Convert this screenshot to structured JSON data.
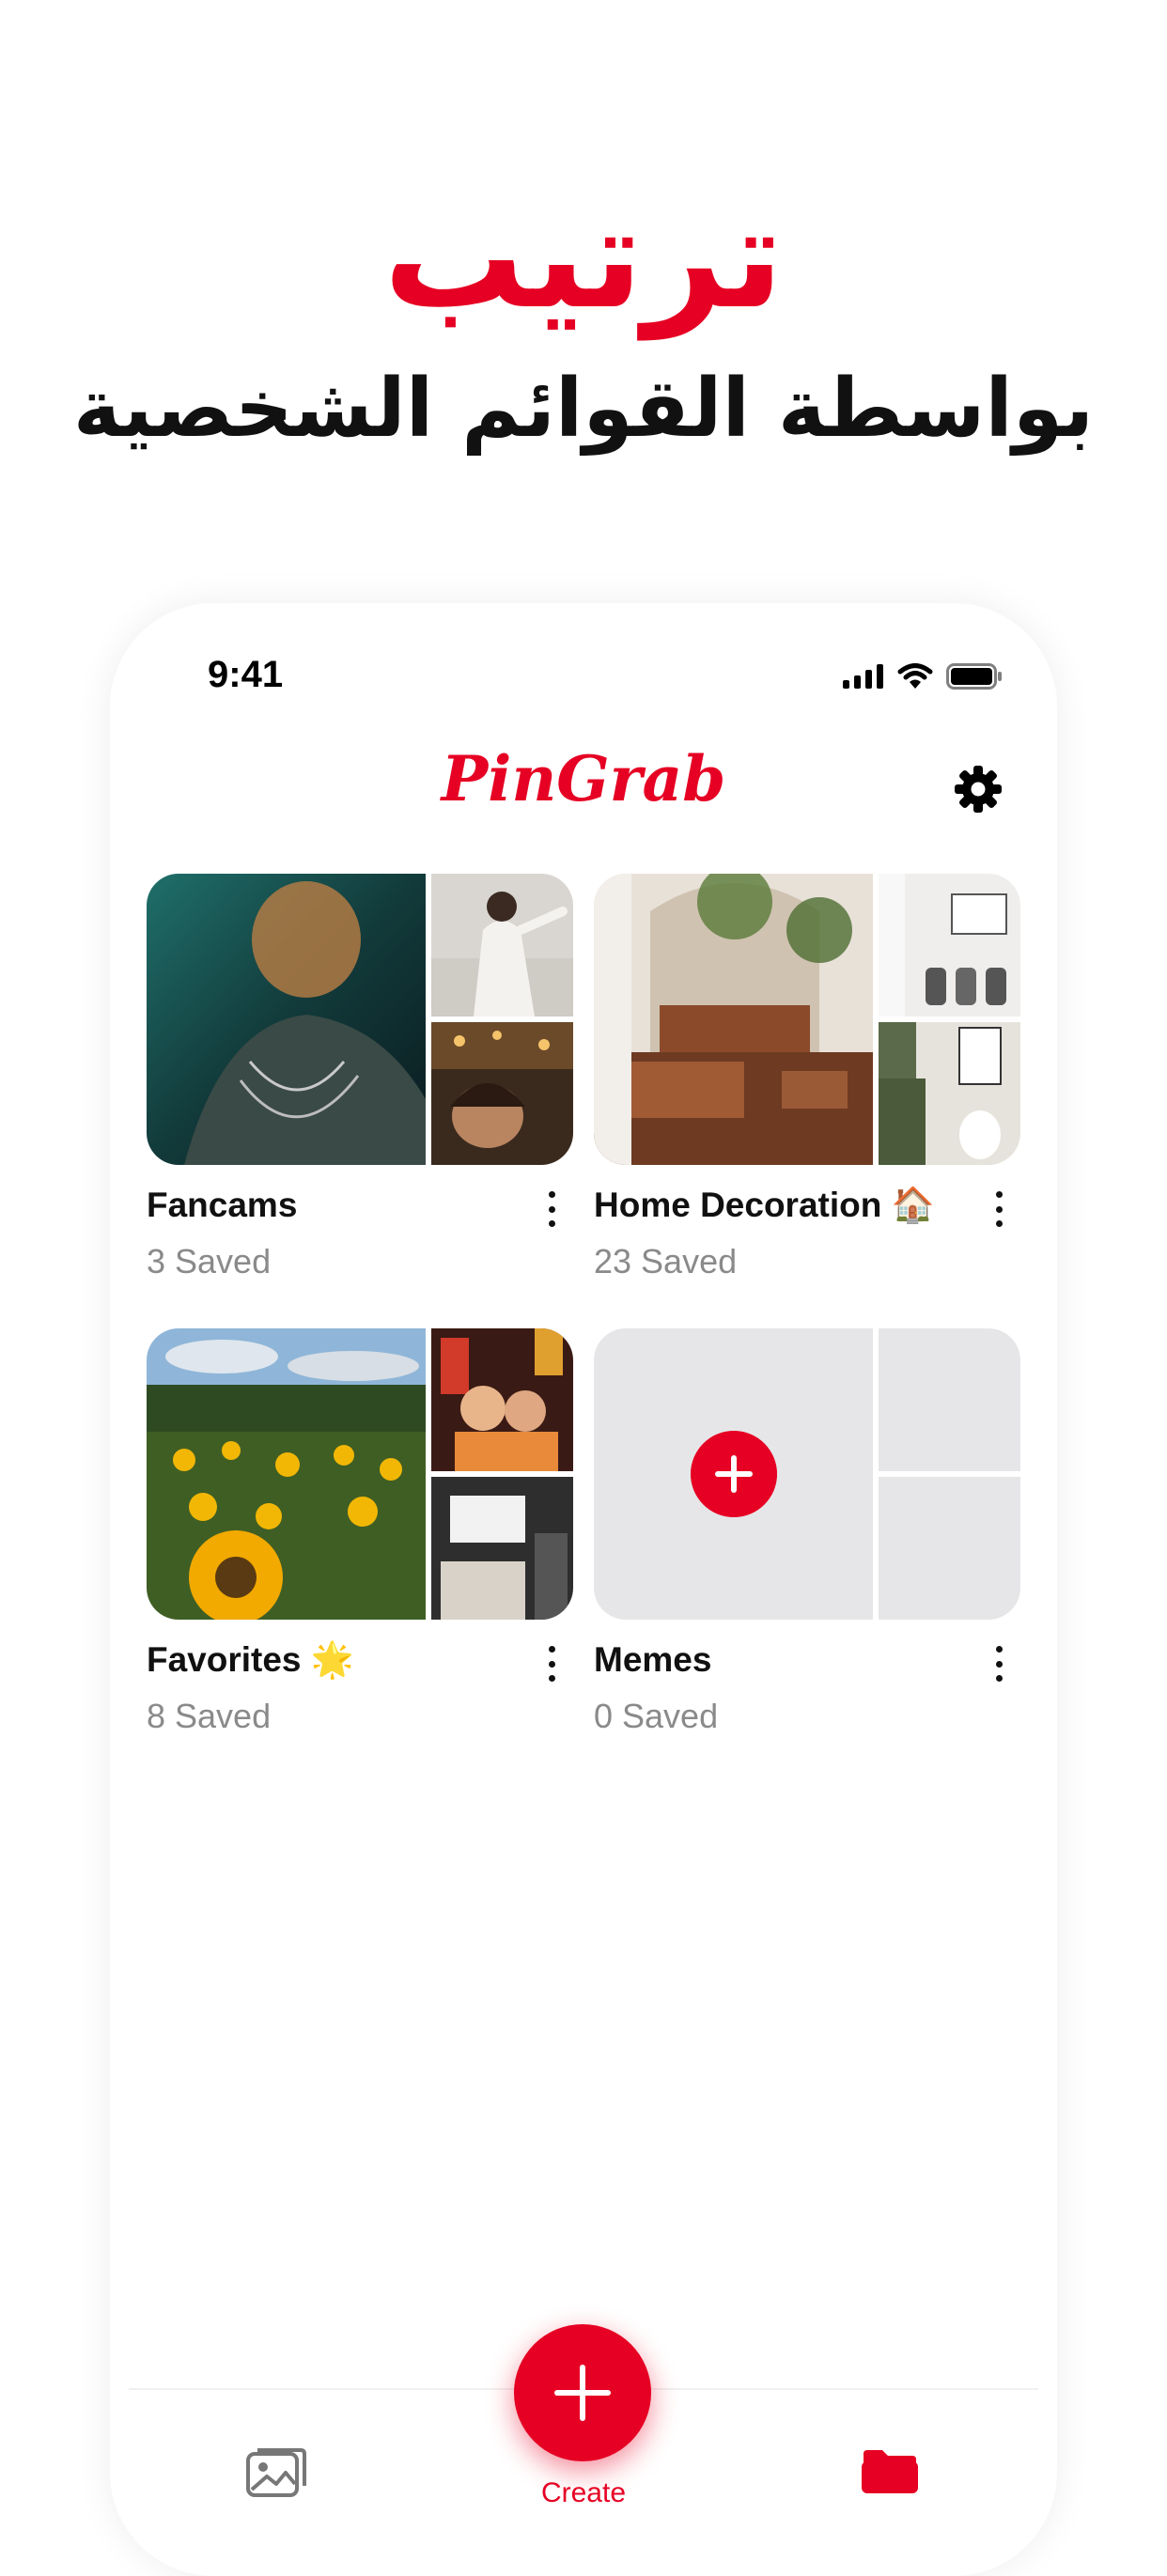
{
  "headline": {
    "title": "ترتيب",
    "subtitle": "بواسطة القوائم الشخصية"
  },
  "status_bar": {
    "time": "9:41",
    "icons": [
      "signal-icon",
      "wifi-icon",
      "battery-icon"
    ]
  },
  "header": {
    "app_name": "PinGrab",
    "settings_icon": "gear-icon"
  },
  "boards": [
    {
      "name": "Fancams",
      "count": "3 Saved",
      "menu_icon": "more-vertical-icon"
    },
    {
      "name": "Home Decoration 🏠",
      "count": "23 Saved",
      "menu_icon": "more-vertical-icon"
    },
    {
      "name": "Favorites 🌟",
      "count": "8 Saved",
      "menu_icon": "more-vertical-icon"
    },
    {
      "name": "Memes",
      "count": "0 Saved",
      "menu_icon": "more-vertical-icon",
      "add_icon": "plus-icon"
    }
  ],
  "tabbar": {
    "left_icon": "gallery-icon",
    "create_label": "Create",
    "create_icon": "plus-icon",
    "right_icon": "folder-icon"
  },
  "colors": {
    "accent": "#e60023",
    "text": "#111111",
    "muted": "#8a8a8a",
    "placeholder": "#e6e6e8"
  }
}
